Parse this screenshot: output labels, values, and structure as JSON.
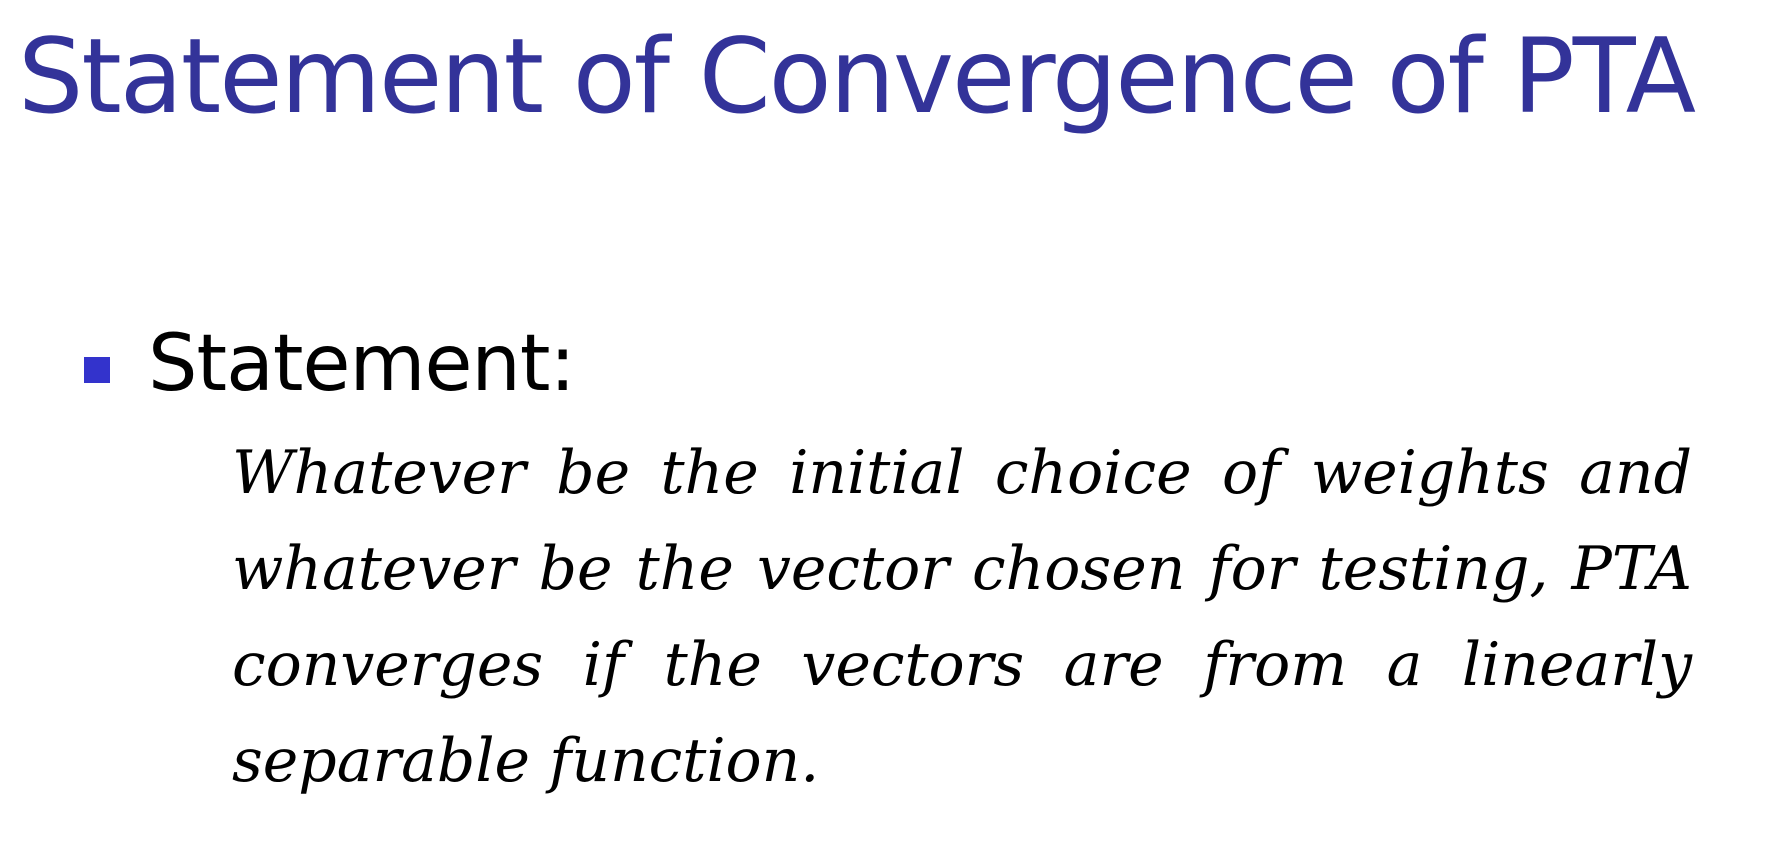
{
  "slide": {
    "title": "Statement of Convergence of PTA",
    "bullet": {
      "label": "Statement:",
      "body": "Whatever be the initial choice of weights and whatever be the vector chosen for testing, PTA converges if the vectors are from a linearly separable function."
    }
  },
  "colors": {
    "title": "#333399",
    "bullet_marker": "#3333cc",
    "text": "#000000",
    "background": "#ffffff"
  }
}
